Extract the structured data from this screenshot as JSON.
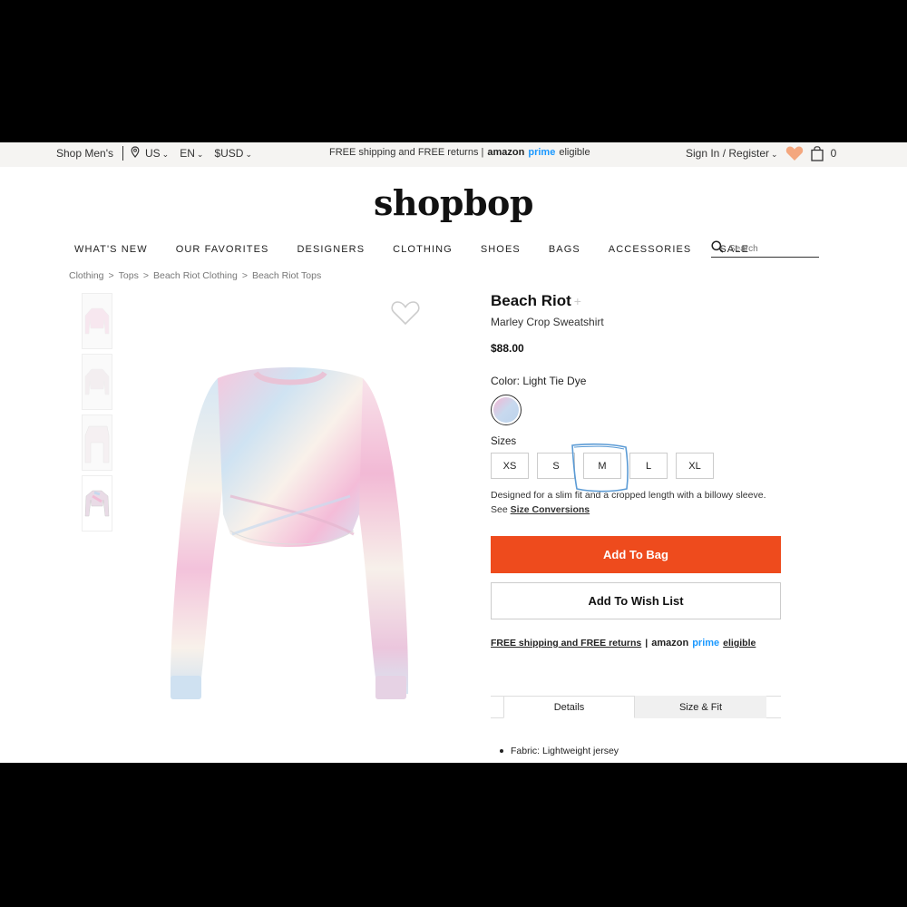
{
  "utility_bar": {
    "shop_mens": "Shop Men's",
    "country": "US",
    "language": "EN",
    "currency": "$USD",
    "promo_text": "FREE shipping and FREE returns |",
    "amazon": "amazon",
    "prime": "prime",
    "eligible": "eligible",
    "sign_in": "Sign In / Register",
    "bag_count": "0"
  },
  "logo": "shopbop",
  "nav": {
    "items": [
      "WHAT'S NEW",
      "OUR FAVORITES",
      "DESIGNERS",
      "CLOTHING",
      "SHOES",
      "BAGS",
      "ACCESSORIES",
      "SALE"
    ],
    "search_placeholder": "Search"
  },
  "breadcrumb": [
    "Clothing",
    "Tops",
    "Beach Riot Clothing",
    "Beach Riot Tops"
  ],
  "product": {
    "brand": "Beach Riot",
    "brand_plus": "+",
    "name": "Marley Crop Sweatshirt",
    "price": "$88.00",
    "color_label": "Color: Light Tie Dye",
    "sizes_label": "Sizes",
    "sizes": [
      "XS",
      "S",
      "M",
      "L",
      "XL"
    ],
    "fit_note": "Designed for a slim fit and a cropped length with a billowy sleeve.",
    "see": "See",
    "size_conversions": "Size Conversions",
    "add_to_bag": "Add To Bag",
    "add_to_wish": "Add To Wish List",
    "ship_text": "FREE shipping and FREE returns",
    "ship_sep": "|",
    "ship_amazon": "amazon",
    "ship_prime": "prime",
    "ship_eligible": "eligible"
  },
  "tabs": [
    "Details",
    "Size & Fit"
  ],
  "details": [
    "Fabric: Lightweight jersey"
  ],
  "colors": {
    "accent": "#ee4b1d",
    "prime_blue": "#1a98ff",
    "heart": "#f4a77e",
    "annotation": "#5b9bd5"
  }
}
